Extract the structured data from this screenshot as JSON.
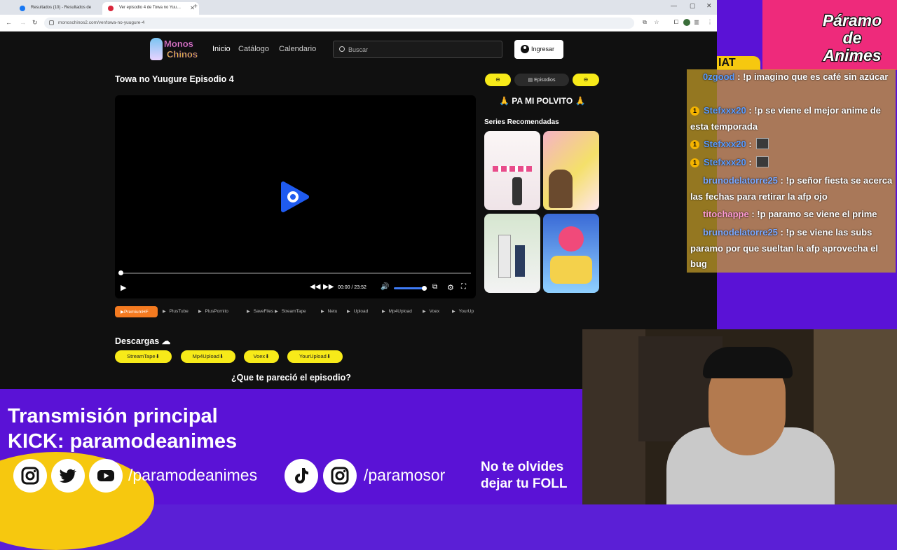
{
  "browser": {
    "tabs": [
      {
        "title": "Resultados (10) - Resultados de",
        "color": "#1877f2"
      },
      {
        "title": "Ver episodio 4 de Towa no Yuu…",
        "color": "#d9263a"
      }
    ],
    "url": "monoschinos2.com/ver/towa-no-yuugure-4"
  },
  "site": {
    "logo": {
      "line1": "Monos",
      "line2": "Chinos"
    },
    "nav": [
      "Inicio",
      "Catálogo",
      "Calendario"
    ],
    "search_placeholder": "Buscar",
    "login_label": "Ingresar",
    "episode_title": "Towa no Yuugure Episodio 4",
    "pills": {
      "prev": "⊖",
      "episodes": "▤ Episodios",
      "next": "⊖"
    },
    "player": {
      "time": "00:00 / 23:52",
      "progress": 0.0,
      "volume": 0.9
    },
    "servers": [
      "PremiumHF",
      "PlusTube",
      "PlusPornito",
      "SaveFiles",
      "StreamTape",
      "Netu",
      "Upload",
      "Mp4Upload",
      "Voex",
      "YourUp"
    ],
    "banner": "🙏 PA MI POLVITO 🙏",
    "recommended_title": "Series Recomendadas",
    "downloads_title": "Descargas",
    "downloads": [
      "StreamTape",
      "Mp4Upload",
      "Voex",
      "YourUpload"
    ],
    "question": "¿Que te pareció el episodio?"
  },
  "overlay": {
    "headline1": "Transmisión principal",
    "headline2": "KICK: paramodeanimes",
    "handle1": "/paramodeanimes",
    "handle2": "/paramosor",
    "reminder1": "No te olvides",
    "reminder2": "dejar tu FOLL",
    "brand1": "Páramo",
    "brand2": "de",
    "brand3": "Animes",
    "chat_tab": "IAT"
  },
  "chat": [
    {
      "user": "0zgood",
      "text": ": !p imagino que es café sin azúcar",
      "badge": "",
      "color": "#5a9cff"
    },
    {
      "user": "Stefxxx20",
      "text": ": !p se viene el mejor anime de esta temporada",
      "badge": "1",
      "color": "#5a9cff"
    },
    {
      "user": "Stefxxx20",
      "text": ":",
      "badge": "1",
      "color": "#5a9cff"
    },
    {
      "user": "Stefxxx20",
      "text": ":",
      "badge": "1",
      "color": "#5a9cff"
    },
    {
      "user": "brunodelatorre25",
      "text": ": !p señor fiesta se acerca las fechas para retirar la afp ojo",
      "badge": "",
      "color": "#7aa8ff"
    },
    {
      "user": "titochappe",
      "text": ": !p paramo se viene el prime",
      "badge": "",
      "color": "#ff9bd2"
    },
    {
      "user": "brunodelatorre25",
      "text": ": !p se viene las subs paramo por que sueltan la afp aprovecha el bug",
      "badge": "",
      "color": "#7aa8ff"
    }
  ]
}
